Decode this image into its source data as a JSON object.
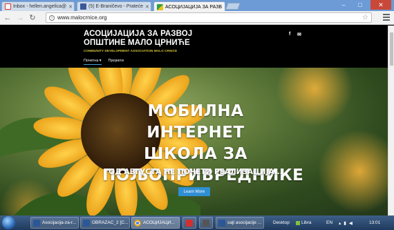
{
  "browser": {
    "tabs": [
      {
        "title": "Inbox - hellen.angelica@",
        "favicon_color": "#d93025",
        "active": false
      },
      {
        "title": "(5) E-Braničevo - Prateće",
        "favicon_color": "#3b5998",
        "active": false
      },
      {
        "title": "АСОЦИЈАЦИЈА ЗА РАЗВ",
        "favicon_color": "#2e9e4a",
        "active": true
      }
    ],
    "url": "www.malocrnice.org",
    "window_controls": {
      "minimize": "–",
      "maximize": "□",
      "close": "✕"
    }
  },
  "site": {
    "title_line1": "АСОЦИЈАЦИЈА ЗА РАЗВОЈ",
    "title_line2": "ОПШТИНЕ МАЛО ЦРНИЋЕ",
    "subtitle": "COMMUNITY DEVELOPMENT ASSOCIATION MALO CRNICE",
    "social": {
      "facebook": "f",
      "email": "✉"
    },
    "nav": [
      {
        "label": "Почетна ▾",
        "active": true
      },
      {
        "label": "Пројекти",
        "active": false
      }
    ]
  },
  "hero": {
    "title_line1": "МОБИЛНА ИНТЕРНЕТ",
    "title_line2": "ШКОЛА ЗА",
    "title_line3": "ПОЉОПРИВРЕДНИКЕ",
    "subtitle": "ОД АВГУСТА ЋЕ ПОЧЕТИ РЕАЛИЗАЦИЈА...",
    "button": "Learn More"
  },
  "taskbar": {
    "items": [
      {
        "label": "Asocijacija-za-r...",
        "icon_color": "#2b5797"
      },
      {
        "label": "OBRAZAC_2 [C...",
        "icon_color": "#2b5797"
      },
      {
        "label": "АСОЦИЈАЦИ...",
        "icon_color": "#e8a317"
      },
      {
        "label": "",
        "icon_color": "#d32f2f"
      },
      {
        "label": "",
        "icon_color": "#555555"
      },
      {
        "label": "sajt asocijacije ...",
        "icon_color": "#2b5797"
      }
    ],
    "tray": {
      "desktop": "Desktop",
      "libra": "Libra",
      "lang": "EN",
      "time": "13:01"
    }
  },
  "colors": {
    "accent": "#2f8fd3",
    "header_bg": "#000000",
    "subtitle_gold": "#d6c53a"
  }
}
